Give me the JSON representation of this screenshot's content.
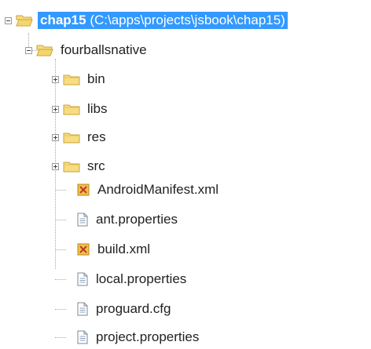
{
  "root": {
    "name": "chap15",
    "path": "(C:\\apps\\projects\\jsbook\\chap15)",
    "expanded": true,
    "selected": true
  },
  "project": {
    "name": "fourballsnative",
    "expanded": true
  },
  "folders": [
    {
      "label": "bin",
      "icon": "folder-icon"
    },
    {
      "label": "libs",
      "icon": "folder-icon"
    },
    {
      "label": "res",
      "icon": "folder-icon"
    },
    {
      "label": "src",
      "icon": "folder-icon"
    }
  ],
  "files": [
    {
      "label": "AndroidManifest.xml",
      "icon": "xml-file-icon"
    },
    {
      "label": "ant.properties",
      "icon": "text-file-icon"
    },
    {
      "label": "build.xml",
      "icon": "xml-file-icon"
    },
    {
      "label": "local.properties",
      "icon": "text-file-icon"
    },
    {
      "label": "proguard.cfg",
      "icon": "text-file-icon"
    },
    {
      "label": "project.properties",
      "icon": "text-file-icon"
    }
  ],
  "colors": {
    "selection": "#3399ff",
    "folder": "#f3d36b",
    "xml": "#e0a020",
    "lines": "#a8a8a8"
  }
}
